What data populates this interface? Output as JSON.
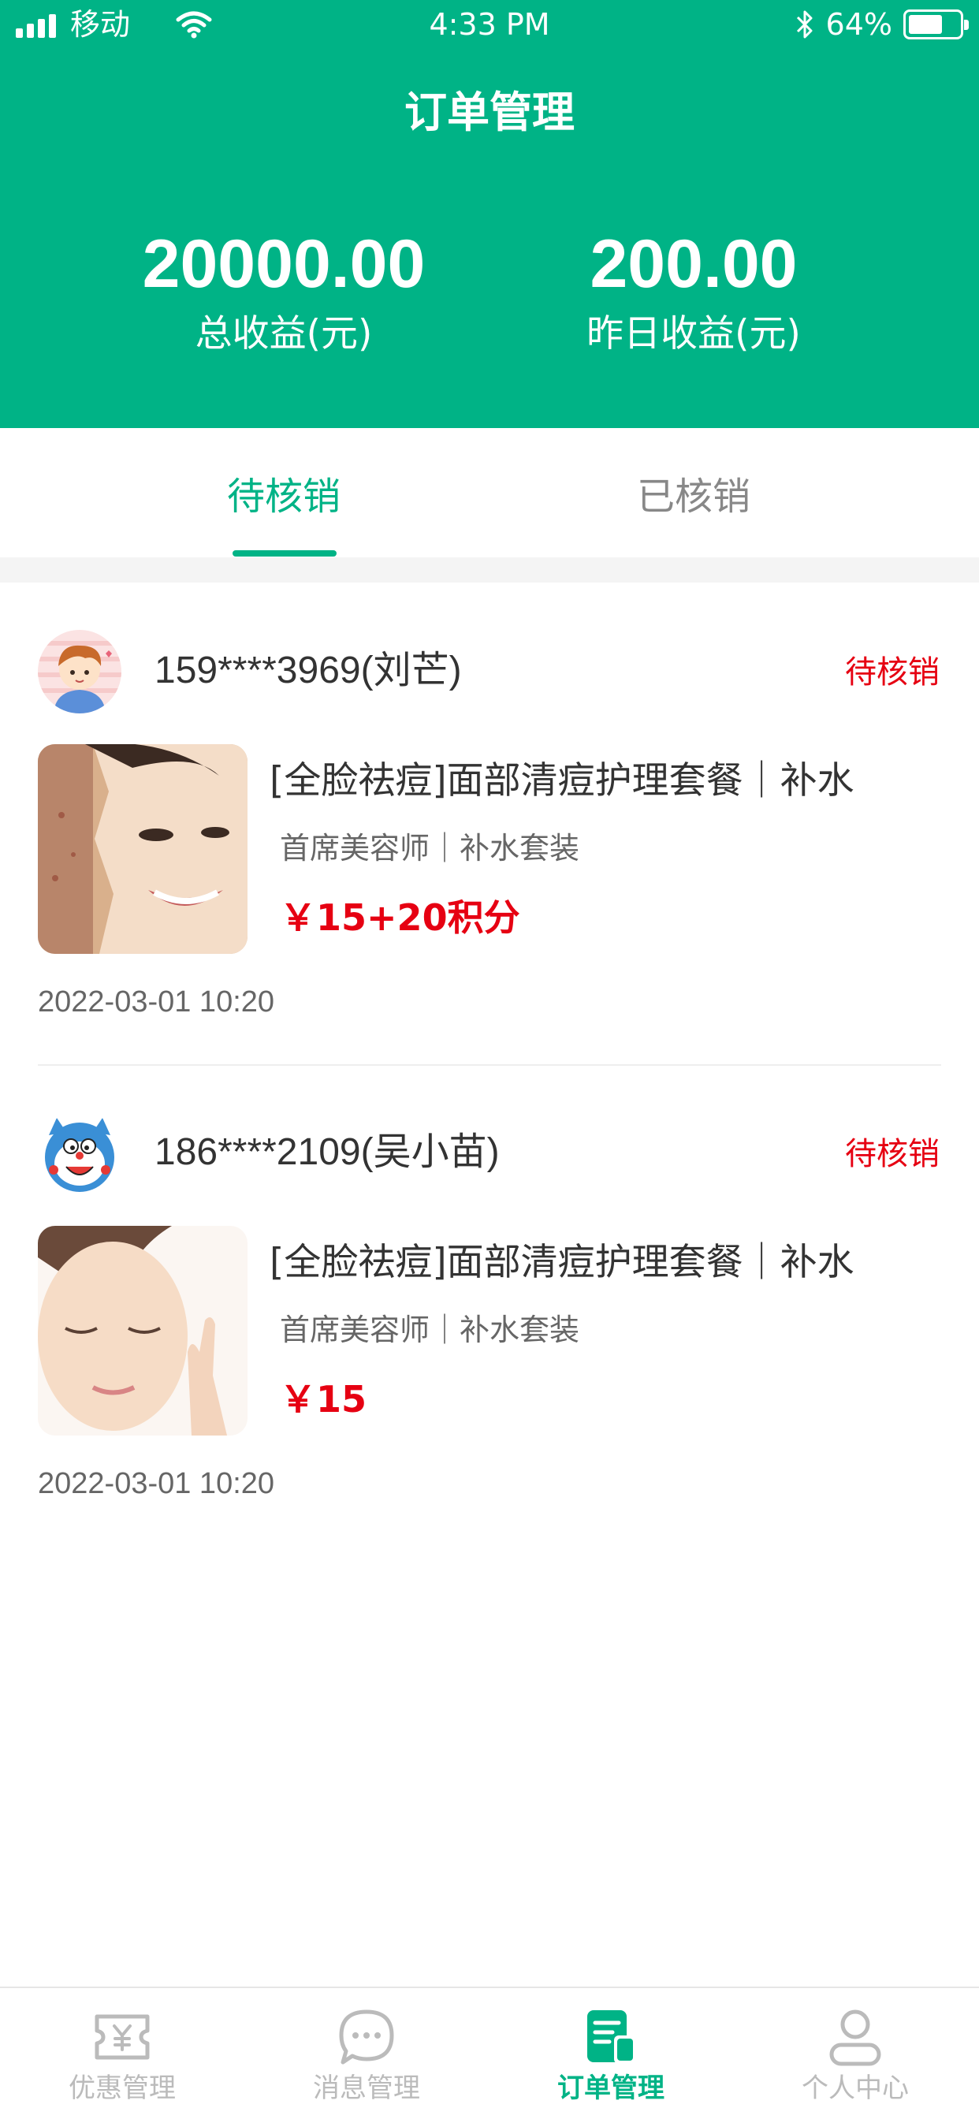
{
  "status_bar": {
    "carrier": "移动",
    "time": "4:33 PM",
    "battery_text": "64%",
    "battery_level": 0.64
  },
  "header": {
    "title": "订单管理",
    "total_earnings": {
      "value": "20000.00",
      "label": "总收益(元)"
    },
    "yesterday_earnings": {
      "value": "200.00",
      "label": "昨日收益(元)"
    }
  },
  "tabs": [
    {
      "label": "待核销",
      "active": true
    },
    {
      "label": "已核销",
      "active": false
    }
  ],
  "orders": [
    {
      "customer": "159****3969(刘芒)",
      "status": "待核销",
      "product_title": "[全脸祛痘]面部清痘护理套餐｜补水",
      "product_spec": "首席美容师｜补水套装",
      "price": "￥15+20积分",
      "time": "2022-03-01  10:20"
    },
    {
      "customer": "186****2109(吴小苗)",
      "status": "待核销",
      "product_title": "[全脸祛痘]面部清痘护理套餐｜补水",
      "product_spec": "首席美容师｜补水套装",
      "price": "￥15",
      "time": "2022-03-01  10:20"
    }
  ],
  "bottom_nav": [
    {
      "label": "优惠管理",
      "icon": "coupon-icon",
      "active": false
    },
    {
      "label": "消息管理",
      "icon": "message-icon",
      "active": false
    },
    {
      "label": "订单管理",
      "icon": "order-icon",
      "active": true
    },
    {
      "label": "个人中心",
      "icon": "user-icon",
      "active": false
    }
  ],
  "colors": {
    "primary": "#00b386",
    "status_red": "#e60012",
    "inactive_gray": "#bbbbbb"
  }
}
